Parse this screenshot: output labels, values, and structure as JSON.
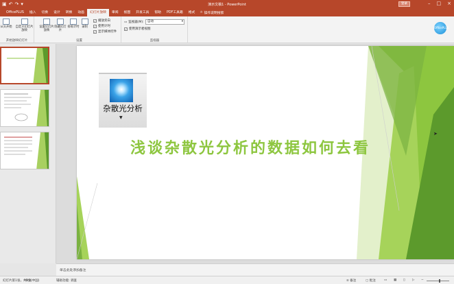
{
  "window": {
    "title": "演示文稿1 - PowerPoint",
    "login_label": "登录",
    "controls": [
      "minimize-icon",
      "restore-icon",
      "close-icon"
    ]
  },
  "qat": [
    "save-icon",
    "undo-icon",
    "redo-icon",
    "customize-icon"
  ],
  "tabs": [
    {
      "label": "OfficePLUS"
    },
    {
      "label": "插入"
    },
    {
      "label": "切换"
    },
    {
      "label": "设计"
    },
    {
      "label": "转换"
    },
    {
      "label": "动画"
    },
    {
      "label": "幻灯片放映",
      "active": true
    },
    {
      "label": "审阅"
    },
    {
      "label": "视图"
    },
    {
      "label": "开发工具"
    },
    {
      "label": "帮助"
    },
    {
      "label": "PDF工具箱"
    },
    {
      "label": "格式"
    }
  ],
  "tell_me": "操作说明搜索",
  "ribbon": {
    "start_group": {
      "buttons": [
        "从头开始",
        "从当前开始",
        "联机演示",
        "自定义幻灯片放映"
      ],
      "label": "开始放映幻灯片"
    },
    "setup_group": {
      "buttons": [
        "设置幻灯片放映",
        "隐藏幻灯片",
        "排练计时",
        "录制"
      ],
      "checks": [
        "播放旁白",
        "使用计时",
        "显示媒体控件"
      ],
      "label": "设置"
    },
    "monitor_group": {
      "monitor_label": "监视器(M):",
      "monitor_value": "自动",
      "presenter_view": "使用演示者视图",
      "label": "监视器"
    }
  },
  "avatar_label": "OfficePLUS",
  "slide": {
    "logo_text": "杂散光分析",
    "title": "浅谈杂散光分析的数据如何去看",
    "colors": {
      "green_light": "#c6e18f",
      "green_mid": "#8dc63f",
      "green_dark": "#5c9a2c"
    }
  },
  "thumbnails": [
    {
      "number": "1",
      "selected": true
    },
    {
      "number": "2",
      "selected": false
    },
    {
      "number": "3",
      "selected": false
    }
  ],
  "notes_placeholder": "单击此处添加备注",
  "status": {
    "slide_info": "幻灯片第1张，共3张",
    "language": "中文(中国)",
    "accessibility": "辅助功能: 调查",
    "notes_label": "备注",
    "comments_label": "批注",
    "zoom": "66%"
  }
}
